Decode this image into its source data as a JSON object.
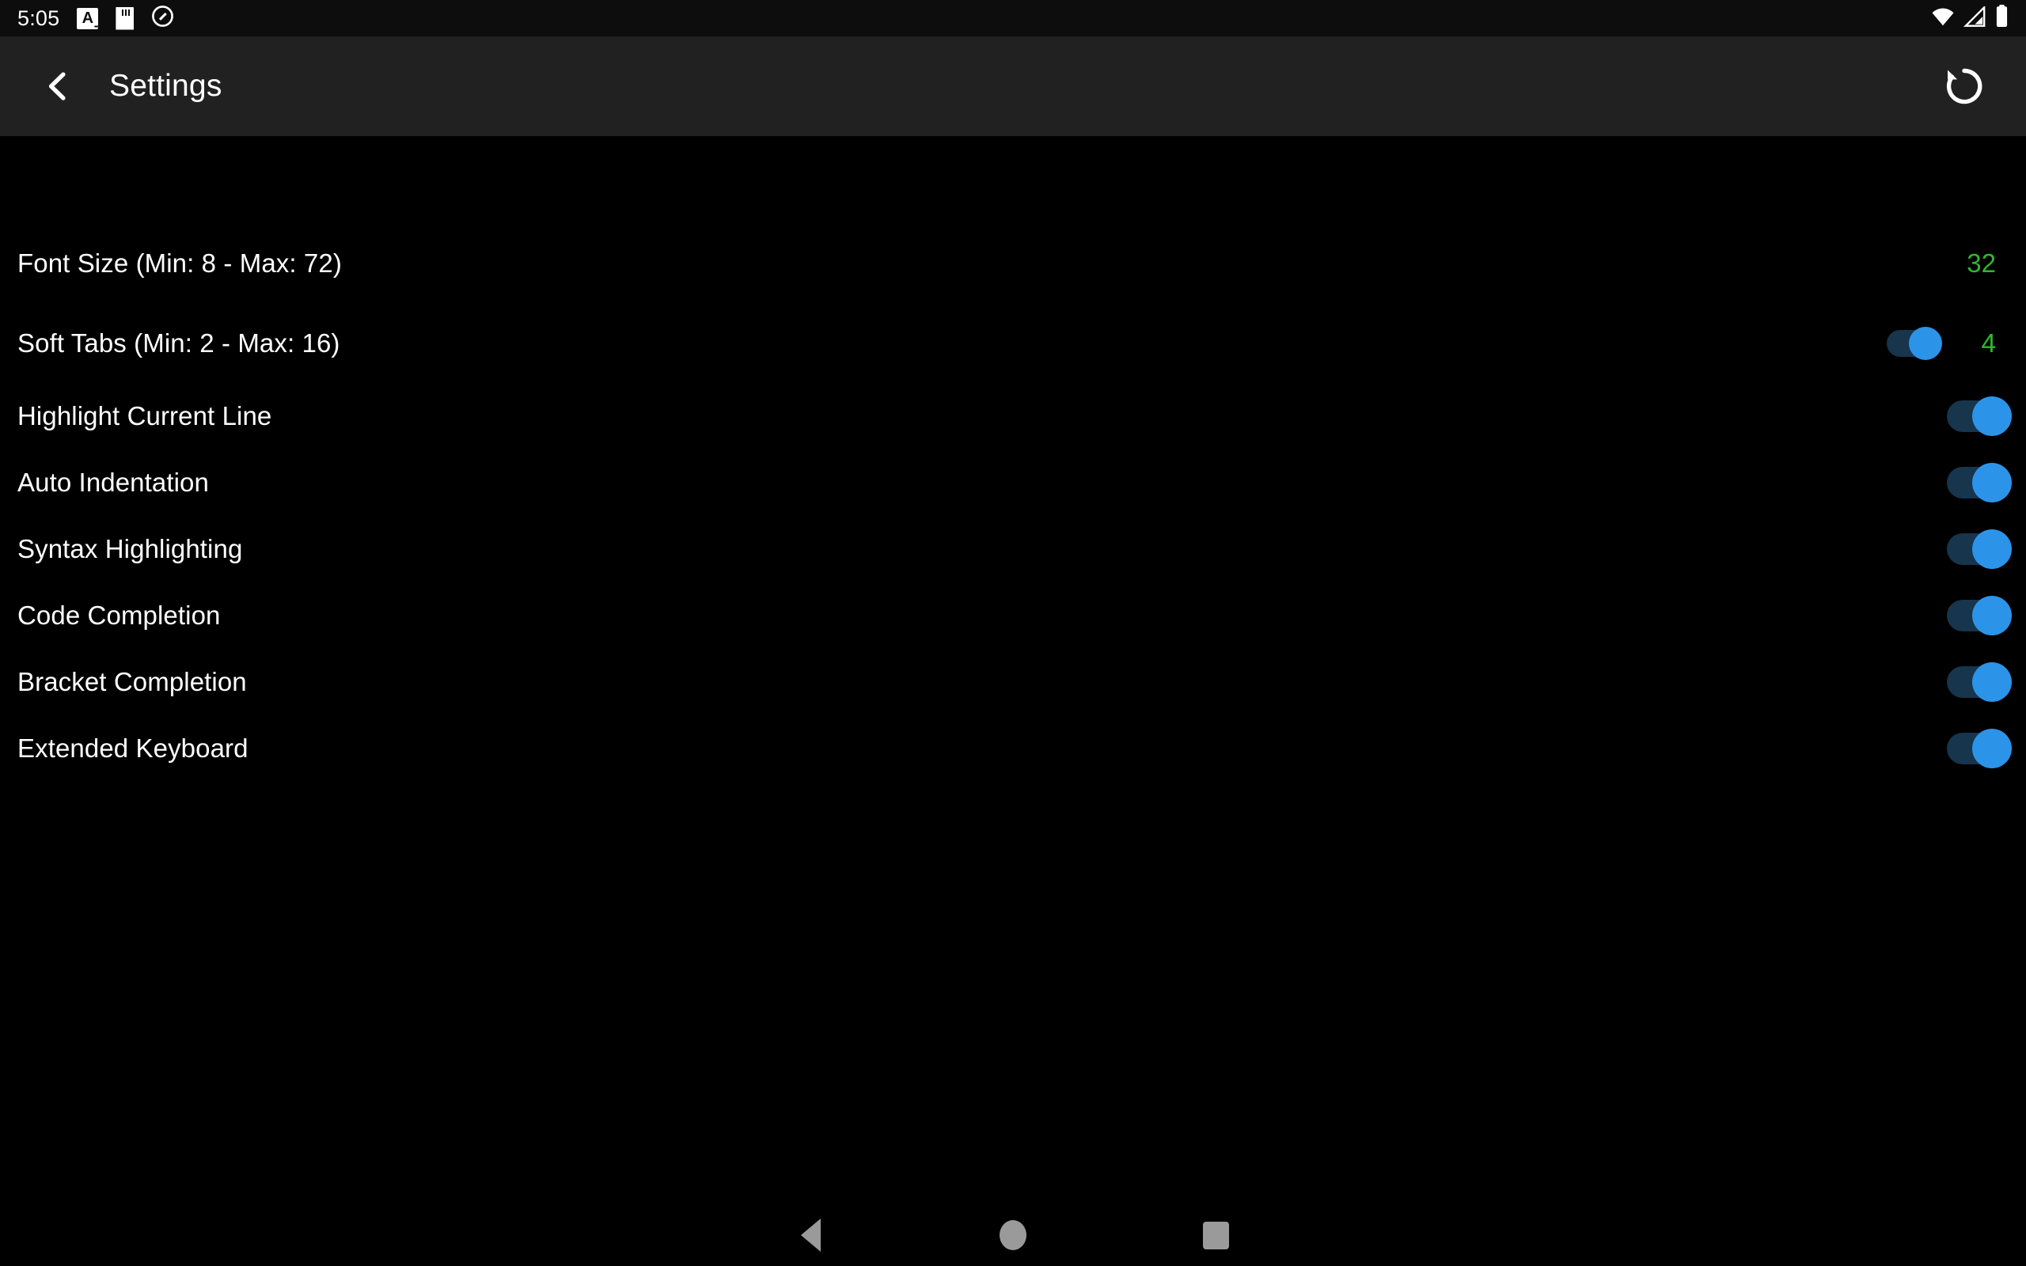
{
  "status_bar": {
    "clock": "5:05",
    "left_icons": [
      {
        "name": "font-size-icon",
        "glyph": "A"
      },
      {
        "name": "sdcard-icon"
      },
      {
        "name": "quiet-mode-icon"
      }
    ],
    "right_icons": [
      {
        "name": "wifi-icon"
      },
      {
        "name": "cellular-signal-icon"
      },
      {
        "name": "battery-icon"
      }
    ]
  },
  "app_bar": {
    "back_icon": "chevron-left-icon",
    "title": "Settings",
    "reset_icon": "rotate-left-reset-icon"
  },
  "colors": {
    "accent_value": "#2eb82e",
    "toggle_thumb_on": "#2b94e8",
    "toggle_track_on": "#17354d",
    "app_bar_bg": "#212121",
    "content_bg": "#000000",
    "status_bar_bg": "#0d0d0d",
    "text_primary": "#ffffff",
    "nav_icon": "#9a9a9a"
  },
  "settings": {
    "rows": [
      {
        "name": "font-size",
        "label": "Font Size (Min: 8 - Max: 72)",
        "value": "32",
        "has_toggle": false,
        "has_value": true,
        "toggle_on": null,
        "toggle_size": null
      },
      {
        "name": "soft-tabs",
        "label": "Soft Tabs (Min: 2 - Max: 16)",
        "value": "4",
        "has_toggle": true,
        "has_value": true,
        "toggle_on": true,
        "toggle_size": "small"
      },
      {
        "name": "highlight-current-line",
        "label": "Highlight Current Line",
        "value": null,
        "has_toggle": true,
        "has_value": false,
        "toggle_on": true,
        "toggle_size": "normal"
      },
      {
        "name": "auto-indentation",
        "label": "Auto Indentation",
        "value": null,
        "has_toggle": true,
        "has_value": false,
        "toggle_on": true,
        "toggle_size": "normal"
      },
      {
        "name": "syntax-highlighting",
        "label": "Syntax Highlighting",
        "value": null,
        "has_toggle": true,
        "has_value": false,
        "toggle_on": true,
        "toggle_size": "normal"
      },
      {
        "name": "code-completion",
        "label": "Code Completion",
        "value": null,
        "has_toggle": true,
        "has_value": false,
        "toggle_on": true,
        "toggle_size": "normal"
      },
      {
        "name": "bracket-completion",
        "label": "Bracket Completion",
        "value": null,
        "has_toggle": true,
        "has_value": false,
        "toggle_on": true,
        "toggle_size": "normal"
      },
      {
        "name": "extended-keyboard",
        "label": "Extended Keyboard",
        "value": null,
        "has_toggle": true,
        "has_value": false,
        "toggle_on": true,
        "toggle_size": "normal"
      }
    ]
  },
  "nav_bar": {
    "buttons": [
      {
        "name": "nav-back-button",
        "icon": "triangle-left-icon"
      },
      {
        "name": "nav-home-button",
        "icon": "circle-icon"
      },
      {
        "name": "nav-recents-button",
        "icon": "square-icon"
      }
    ]
  }
}
